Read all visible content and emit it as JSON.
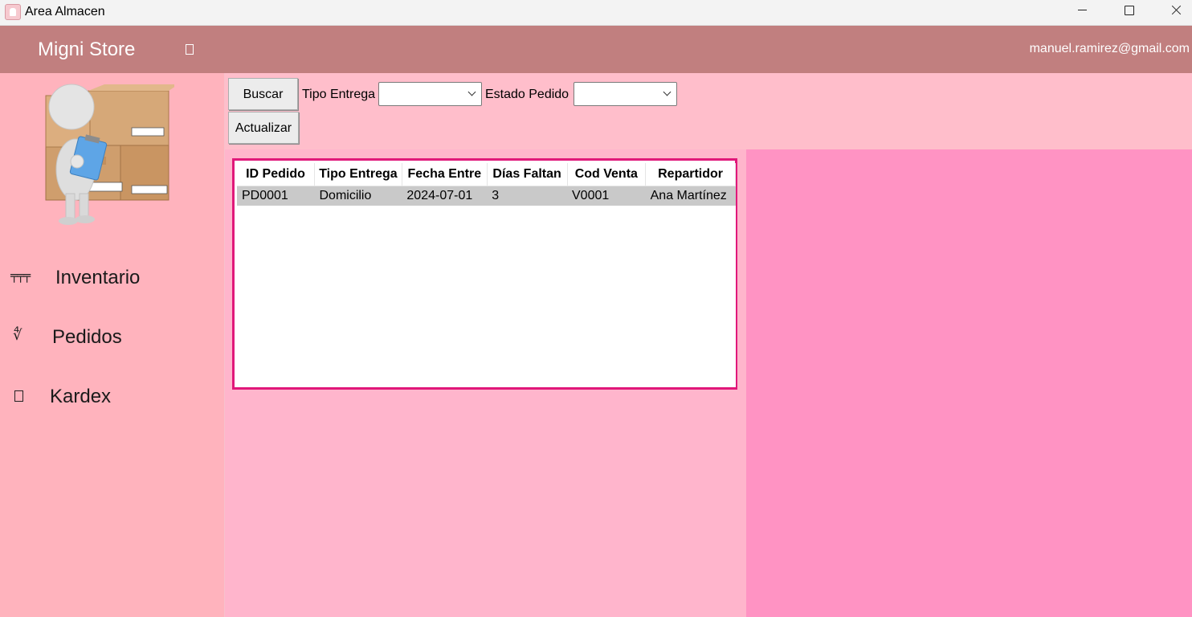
{
  "window": {
    "title": "Area Almacen",
    "icon": "app-icon",
    "controls": [
      "minimize",
      "maximize",
      "close"
    ]
  },
  "header": {
    "brand": "Migni Store",
    "menu_icon": "menu-icon",
    "user_email": "manuel.ramirez@gmail.com",
    "color": "#c17f7f"
  },
  "sidebar": {
    "illustration": "warehouse-worker-with-boxes",
    "items": [
      {
        "label": "Inventario",
        "icon": "inventory-icon"
      },
      {
        "label": "Pedidos",
        "icon": "orders-icon"
      },
      {
        "label": "Kardex",
        "icon": "kardex-icon"
      }
    ]
  },
  "toolbar": {
    "search_label": "Buscar",
    "refresh_label": "Actualizar",
    "delivery_type_label": "Tipo Entrega",
    "delivery_type_value": "",
    "order_status_label": "Estado Pedido",
    "order_status_value": ""
  },
  "orders_table": {
    "columns": [
      "ID Pedido",
      "Tipo Entrega",
      "Fecha Entre",
      "Días Faltan",
      "Cod Venta",
      "Repartidor"
    ],
    "rows": [
      [
        "PD0001",
        "Domicilio",
        "2024-07-01",
        "3",
        "V0001",
        "Ana Martínez"
      ]
    ]
  },
  "colors": {
    "sidebar": "#ffb3bd",
    "main": "#ffbecb",
    "right_panel": "#ff93c3",
    "grid_border": "#e0187a",
    "selected_row": "#c9c9c9"
  }
}
